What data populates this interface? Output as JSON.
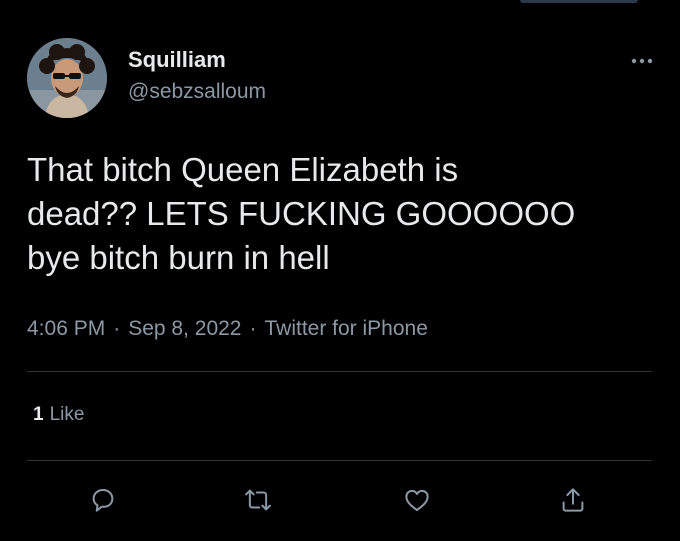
{
  "tweet": {
    "author": {
      "display_name": "Squilliam",
      "handle": "@sebzsalloum",
      "avatar_icon": "profile-photo-avatar"
    },
    "text": "That bitch Queen Elizabeth is\ndead?? LETS FUCKING GOOOOOO\nbye bitch burn in hell",
    "time": "4:06 PM",
    "date": "Sep 8, 2022",
    "source": "Twitter for iPhone",
    "separator": "·",
    "likes_count": "1",
    "likes_label": "Like"
  },
  "icons": {
    "more": "more-horizontal-icon",
    "reply": "reply-icon",
    "retweet": "retweet-icon",
    "like": "heart-icon",
    "share": "share-icon"
  },
  "colors": {
    "background": "#000000",
    "primary_text": "#e7e9ea",
    "secondary_text": "#8b98a5",
    "divider": "#2f3336"
  }
}
